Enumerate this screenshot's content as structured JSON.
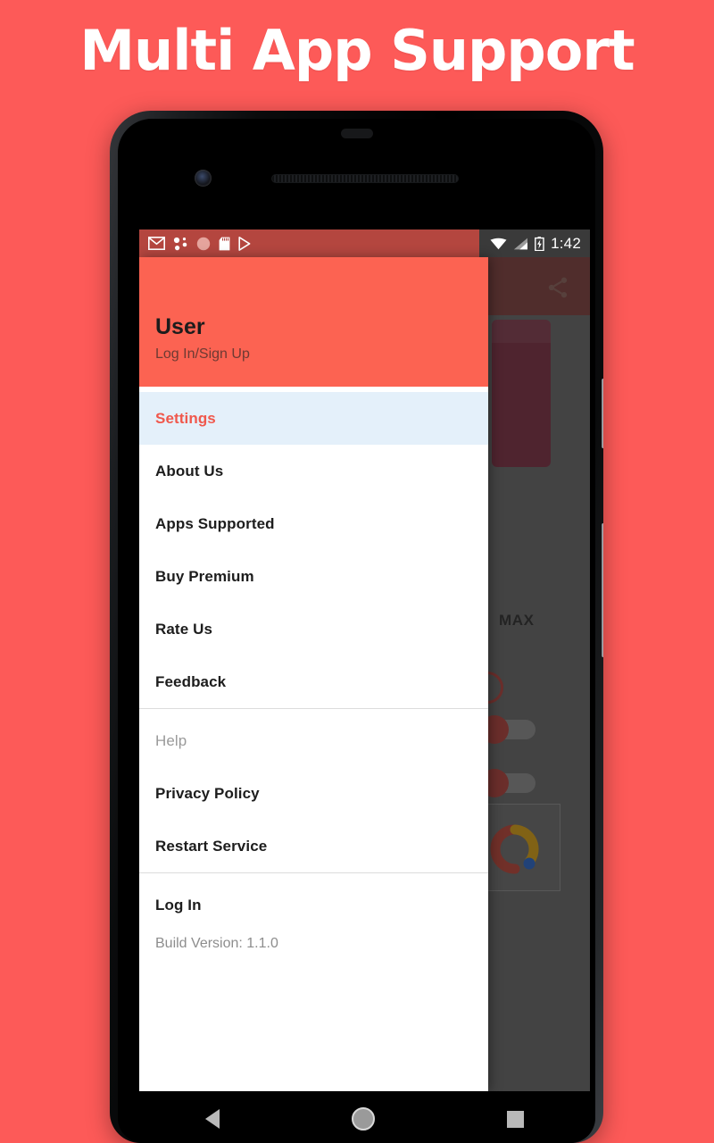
{
  "banner": {
    "title": "Multi App Support",
    "background_color": "#fd5a58",
    "title_color": "#ffffff"
  },
  "status_bar": {
    "time": "1:42",
    "left_icons": [
      "gmail-icon",
      "dots-cluster-icon",
      "circle-icon",
      "sd-card-icon",
      "play-store-icon"
    ],
    "right_icons": [
      "wifi-icon",
      "cellular-signal-icon",
      "battery-charging-icon"
    ],
    "background_color": "#b4463f"
  },
  "app": {
    "toolbar": {
      "share_label": "Share",
      "background_color": "#7b3430"
    },
    "background": {
      "max_label": "MAX",
      "ad_icon": "admob-icon",
      "card_color": "#7a2137",
      "scrim_color": "rgba(40,40,40,0.52)"
    }
  },
  "drawer": {
    "header": {
      "user_name": "User",
      "auth_prompt": "Log In/Sign Up",
      "background_color": "#fc6352"
    },
    "accent_color": "#f0584c",
    "selected_background": "#e4f0fa",
    "primary_items": [
      {
        "label": "Settings",
        "selected": true
      },
      {
        "label": "About Us",
        "selected": false
      },
      {
        "label": "Apps Supported",
        "selected": false
      },
      {
        "label": "Buy Premium",
        "selected": false
      },
      {
        "label": "Rate Us",
        "selected": false
      },
      {
        "label": "Feedback",
        "selected": false
      }
    ],
    "help_section": {
      "title": "Help",
      "items": [
        {
          "label": "Privacy Policy"
        },
        {
          "label": "Restart Service"
        }
      ]
    },
    "footer_items": [
      {
        "label": "Log In"
      }
    ],
    "build_version": "Build Version: 1.1.0"
  },
  "nav_bar": {
    "back_label": "Back",
    "home_label": "Home",
    "recents_label": "Recent apps"
  }
}
